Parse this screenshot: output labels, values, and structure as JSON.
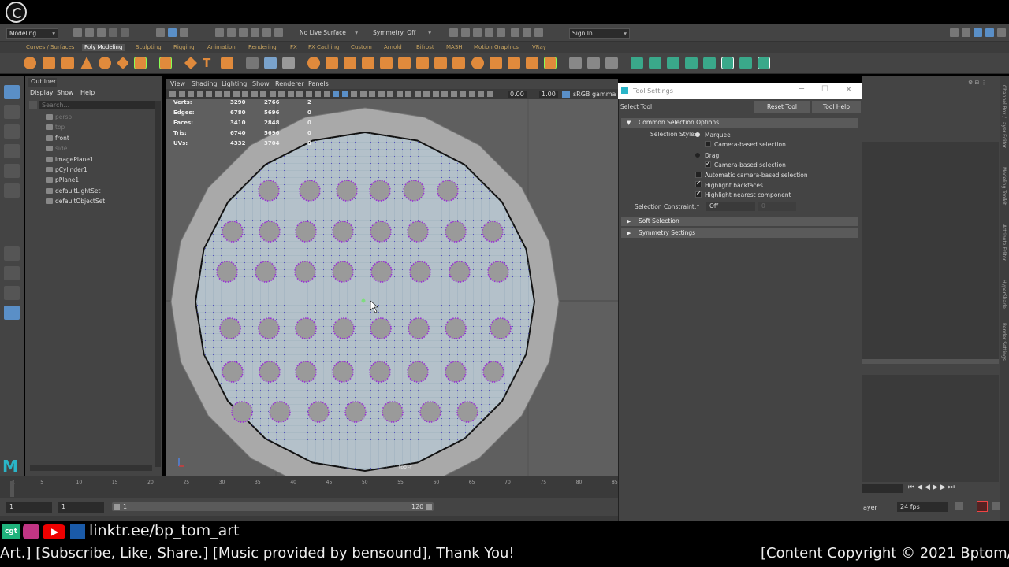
{
  "menubar": {
    "mode": "Modeling",
    "live_surface": "No Live Surface",
    "symmetry": "Symmetry: Off",
    "sign_in": "Sign In"
  },
  "shelf_tabs": [
    "Curves / Surfaces",
    "Poly Modeling",
    "Sculpting",
    "Rigging",
    "Animation",
    "Rendering",
    "FX",
    "FX Caching",
    "Custom",
    "Arnold",
    "Bifrost",
    "MASH",
    "Motion Graphics",
    "VRay"
  ],
  "active_shelf_tab": "Poly Modeling",
  "outliner": {
    "title": "Outliner",
    "menu": [
      "Display",
      "Show",
      "Help"
    ],
    "search_placeholder": "Search...",
    "items": [
      {
        "label": "persp",
        "dim": true,
        "icon": "camera-icon"
      },
      {
        "label": "top",
        "dim": true,
        "icon": "camera-icon"
      },
      {
        "label": "front",
        "dim": false,
        "icon": "camera-icon"
      },
      {
        "label": "side",
        "dim": true,
        "icon": "camera-icon"
      },
      {
        "label": "imagePlane1",
        "dim": false,
        "icon": "image-plane-icon"
      },
      {
        "label": "pCylinder1",
        "dim": false,
        "icon": "mesh-icon"
      },
      {
        "label": "pPlane1",
        "dim": false,
        "icon": "mesh-icon"
      },
      {
        "label": "defaultLightSet",
        "dim": false,
        "icon": "set-icon"
      },
      {
        "label": "defaultObjectSet",
        "dim": false,
        "icon": "set-icon"
      }
    ]
  },
  "viewport": {
    "menu": [
      "View",
      "Shading",
      "Lighting",
      "Show",
      "Renderer",
      "Panels"
    ],
    "exposure": "0.00",
    "gamma": "1.00",
    "color_space": "sRGB gamma",
    "camera_label": "top -Y",
    "hud": [
      {
        "label": "Verts:",
        "a": "3290",
        "b": "2766",
        "c": "2"
      },
      {
        "label": "Edges:",
        "a": "6780",
        "b": "5696",
        "c": "0"
      },
      {
        "label": "Faces:",
        "a": "3410",
        "b": "2848",
        "c": "0"
      },
      {
        "label": "Tris:",
        "a": "6740",
        "b": "5696",
        "c": "0"
      },
      {
        "label": "UVs:",
        "a": "4332",
        "b": "3704",
        "c": "0"
      }
    ]
  },
  "timeline": {
    "ticks": [
      "1",
      "5",
      "10",
      "15",
      "20",
      "25",
      "30",
      "35",
      "40",
      "45",
      "50",
      "55",
      "60",
      "65",
      "70",
      "75",
      "80",
      "85"
    ],
    "start": "1",
    "current": "1",
    "range_start": "1",
    "range_end": "120"
  },
  "tool_settings": {
    "title": "Tool Settings",
    "tool_name": "Select Tool",
    "reset_button": "Reset Tool",
    "help_button": "Tool Help",
    "section_common": "Common Selection Options",
    "selection_style_label": "Selection Style:",
    "marquee": "Marquee",
    "camera_based_1": "Camera-based selection",
    "drag": "Drag",
    "camera_based_2": "Camera-based selection",
    "auto_camera": "Automatic camera-based selection",
    "highlight_backfaces": "Highlight backfaces",
    "highlight_nearest": "Highlight nearest component",
    "constraint_label": "Selection Constraint:",
    "constraint_value": "Off",
    "constraint_num": "0",
    "section_soft": "Soft Selection",
    "section_symmetry": "Symmetry Settings"
  },
  "right_panel": {
    "vertical_tabs": [
      "Channel Box / Layer Editor",
      "Modeling Toolkit",
      "Attribute Editor",
      "HyperShade",
      "Render Settings"
    ],
    "layer_label": "ayer",
    "fps": "24 fps"
  },
  "overlay": {
    "link": "linktr.ee/bp_tom_art",
    "credits": "Art.] [Subscribe, Like, Share.] [Music provided by bensound], Thank You!",
    "copyright": "[Content Copyright © 2021 Bptom/"
  }
}
